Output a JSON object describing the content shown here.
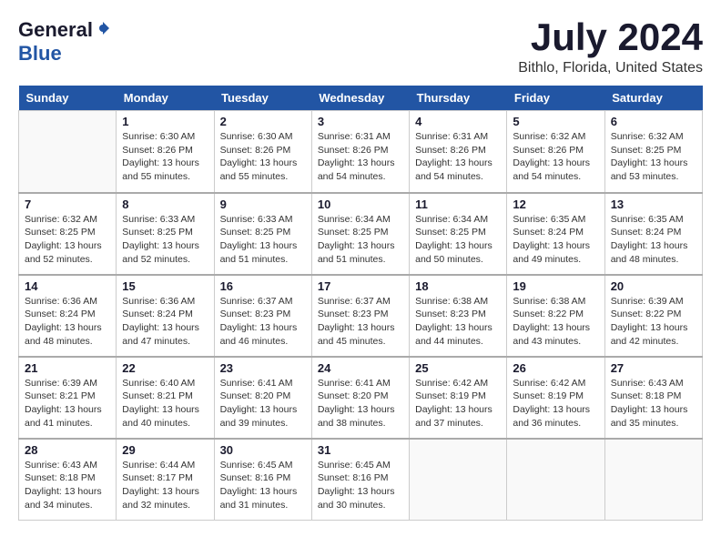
{
  "logo": {
    "general": "General",
    "blue": "Blue"
  },
  "title": {
    "month_year": "July 2024",
    "location": "Bithlo, Florida, United States"
  },
  "days_of_week": [
    "Sunday",
    "Monday",
    "Tuesday",
    "Wednesday",
    "Thursday",
    "Friday",
    "Saturday"
  ],
  "weeks": [
    [
      {
        "day": "",
        "info": ""
      },
      {
        "day": "1",
        "info": "Sunrise: 6:30 AM\nSunset: 8:26 PM\nDaylight: 13 hours\nand 55 minutes."
      },
      {
        "day": "2",
        "info": "Sunrise: 6:30 AM\nSunset: 8:26 PM\nDaylight: 13 hours\nand 55 minutes."
      },
      {
        "day": "3",
        "info": "Sunrise: 6:31 AM\nSunset: 8:26 PM\nDaylight: 13 hours\nand 54 minutes."
      },
      {
        "day": "4",
        "info": "Sunrise: 6:31 AM\nSunset: 8:26 PM\nDaylight: 13 hours\nand 54 minutes."
      },
      {
        "day": "5",
        "info": "Sunrise: 6:32 AM\nSunset: 8:26 PM\nDaylight: 13 hours\nand 54 minutes."
      },
      {
        "day": "6",
        "info": "Sunrise: 6:32 AM\nSunset: 8:25 PM\nDaylight: 13 hours\nand 53 minutes."
      }
    ],
    [
      {
        "day": "7",
        "info": "Sunrise: 6:32 AM\nSunset: 8:25 PM\nDaylight: 13 hours\nand 52 minutes."
      },
      {
        "day": "8",
        "info": "Sunrise: 6:33 AM\nSunset: 8:25 PM\nDaylight: 13 hours\nand 52 minutes."
      },
      {
        "day": "9",
        "info": "Sunrise: 6:33 AM\nSunset: 8:25 PM\nDaylight: 13 hours\nand 51 minutes."
      },
      {
        "day": "10",
        "info": "Sunrise: 6:34 AM\nSunset: 8:25 PM\nDaylight: 13 hours\nand 51 minutes."
      },
      {
        "day": "11",
        "info": "Sunrise: 6:34 AM\nSunset: 8:25 PM\nDaylight: 13 hours\nand 50 minutes."
      },
      {
        "day": "12",
        "info": "Sunrise: 6:35 AM\nSunset: 8:24 PM\nDaylight: 13 hours\nand 49 minutes."
      },
      {
        "day": "13",
        "info": "Sunrise: 6:35 AM\nSunset: 8:24 PM\nDaylight: 13 hours\nand 48 minutes."
      }
    ],
    [
      {
        "day": "14",
        "info": "Sunrise: 6:36 AM\nSunset: 8:24 PM\nDaylight: 13 hours\nand 48 minutes."
      },
      {
        "day": "15",
        "info": "Sunrise: 6:36 AM\nSunset: 8:24 PM\nDaylight: 13 hours\nand 47 minutes."
      },
      {
        "day": "16",
        "info": "Sunrise: 6:37 AM\nSunset: 8:23 PM\nDaylight: 13 hours\nand 46 minutes."
      },
      {
        "day": "17",
        "info": "Sunrise: 6:37 AM\nSunset: 8:23 PM\nDaylight: 13 hours\nand 45 minutes."
      },
      {
        "day": "18",
        "info": "Sunrise: 6:38 AM\nSunset: 8:23 PM\nDaylight: 13 hours\nand 44 minutes."
      },
      {
        "day": "19",
        "info": "Sunrise: 6:38 AM\nSunset: 8:22 PM\nDaylight: 13 hours\nand 43 minutes."
      },
      {
        "day": "20",
        "info": "Sunrise: 6:39 AM\nSunset: 8:22 PM\nDaylight: 13 hours\nand 42 minutes."
      }
    ],
    [
      {
        "day": "21",
        "info": "Sunrise: 6:39 AM\nSunset: 8:21 PM\nDaylight: 13 hours\nand 41 minutes."
      },
      {
        "day": "22",
        "info": "Sunrise: 6:40 AM\nSunset: 8:21 PM\nDaylight: 13 hours\nand 40 minutes."
      },
      {
        "day": "23",
        "info": "Sunrise: 6:41 AM\nSunset: 8:20 PM\nDaylight: 13 hours\nand 39 minutes."
      },
      {
        "day": "24",
        "info": "Sunrise: 6:41 AM\nSunset: 8:20 PM\nDaylight: 13 hours\nand 38 minutes."
      },
      {
        "day": "25",
        "info": "Sunrise: 6:42 AM\nSunset: 8:19 PM\nDaylight: 13 hours\nand 37 minutes."
      },
      {
        "day": "26",
        "info": "Sunrise: 6:42 AM\nSunset: 8:19 PM\nDaylight: 13 hours\nand 36 minutes."
      },
      {
        "day": "27",
        "info": "Sunrise: 6:43 AM\nSunset: 8:18 PM\nDaylight: 13 hours\nand 35 minutes."
      }
    ],
    [
      {
        "day": "28",
        "info": "Sunrise: 6:43 AM\nSunset: 8:18 PM\nDaylight: 13 hours\nand 34 minutes."
      },
      {
        "day": "29",
        "info": "Sunrise: 6:44 AM\nSunset: 8:17 PM\nDaylight: 13 hours\nand 32 minutes."
      },
      {
        "day": "30",
        "info": "Sunrise: 6:45 AM\nSunset: 8:16 PM\nDaylight: 13 hours\nand 31 minutes."
      },
      {
        "day": "31",
        "info": "Sunrise: 6:45 AM\nSunset: 8:16 PM\nDaylight: 13 hours\nand 30 minutes."
      },
      {
        "day": "",
        "info": ""
      },
      {
        "day": "",
        "info": ""
      },
      {
        "day": "",
        "info": ""
      }
    ]
  ]
}
